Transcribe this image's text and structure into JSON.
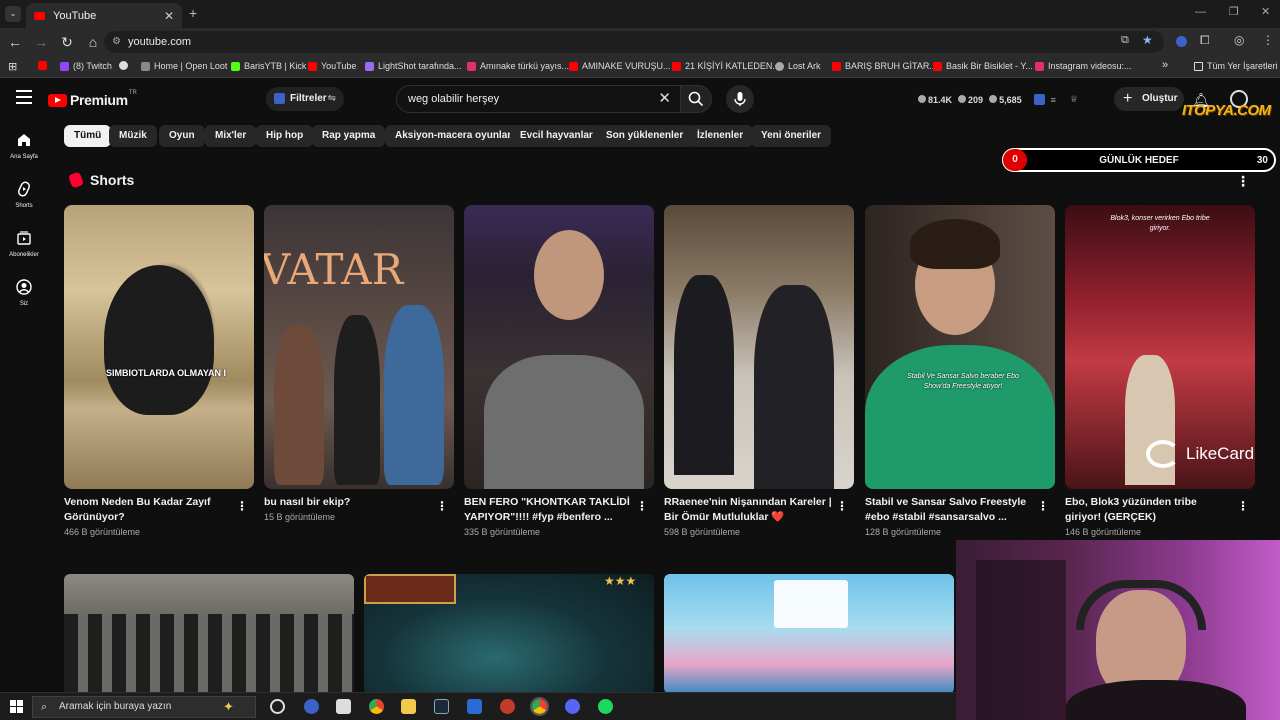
{
  "browser": {
    "tab_title": "YouTube",
    "url": "youtube.com",
    "bookmarks": [
      {
        "label": "(8) Twitch",
        "color": "#9146ff"
      },
      {
        "label": "Home | Open Loot",
        "color": "#888888"
      },
      {
        "label": "BarisYTB | Kick",
        "color": "#53fc18"
      },
      {
        "label": "YouTube",
        "color": "#ff0000"
      },
      {
        "label": "LightShot tarafında...",
        "color": "#9b6cf2"
      },
      {
        "label": "Amınake türkü yayıs...",
        "color": "#e1306c"
      },
      {
        "label": "AMINAKE VURUŞU...",
        "color": "#ff0000"
      },
      {
        "label": "21 KİŞİYİ KATLEDEN...",
        "color": "#ff0000"
      },
      {
        "label": "Lost Ark",
        "color": "#aaaaaa"
      },
      {
        "label": "BARIŞ BRUH GİTAR...",
        "color": "#ff0000"
      },
      {
        "label": "Basik Bir Bisiklet - Y...",
        "color": "#ff0000"
      },
      {
        "label": "Instagram videosu:...",
        "color": "#e1306c"
      }
    ],
    "all_bookmarks": "Tüm Yer İşaretleri"
  },
  "yt_header": {
    "logo": "Premium",
    "logo_region": "TR",
    "filters_label": "Filtreler",
    "search_value": "weg olabilir herşey",
    "stat1": "81.4K",
    "stat2": "209",
    "stat3": "5,685",
    "create_label": "Oluştur"
  },
  "overlay": {
    "watermark": "ITOPYA.COM",
    "goal_start": "0",
    "goal_label": "GÜNLÜK HEDEF",
    "goal_target": "30",
    "likecard": "LikeCard"
  },
  "sidebar": [
    {
      "label": "Ana Sayfa"
    },
    {
      "label": "Shorts"
    },
    {
      "label": "Abonelikler"
    },
    {
      "label": "Siz"
    }
  ],
  "chips": [
    "Tümü",
    "Müzik",
    "Oyun",
    "Mix'ler",
    "Hip hop",
    "Rap yapma",
    "Aksiyon-macera oyunları",
    "Evcil hayvanlar",
    "Son yüklenenler",
    "İzlenenler",
    "Yeni öneriler"
  ],
  "shorts": {
    "section_title": "Shorts",
    "items": [
      {
        "title": "Venom Neden Bu Kadar Zayıf Görünüyor?",
        "views": "466 B görüntüleme",
        "caption": "SIMBIOTLARDA OLMAYAN I"
      },
      {
        "title": "bu nasıl bir ekip?",
        "views": "15 B görüntüleme",
        "caption": "VATAR"
      },
      {
        "title": "BEN FERO \"KHONTKAR TAKLİDİ YAPIYOR\"!!!! #fyp #benfero ...",
        "views": "335 B görüntüleme",
        "caption": ""
      },
      {
        "title": "RRaenee'nin Nişanından Kareler | Bir Ömür Mutluluklar ❤️",
        "views": "598 B görüntüleme",
        "caption": ""
      },
      {
        "title": "Stabil ve Sansar Salvo Freestyle #ebo #stabil #sansarsalvo ...",
        "views": "128 B görüntüleme",
        "caption": "Stabil Ve Sansar Salvo beraber Ebo Show'da Freestyle atıyor!"
      },
      {
        "title": "Ebo, Blok3 yüzünden tribe giriyor! (GERÇEK)",
        "views": "146 B görüntüleme",
        "caption": "Blok3, konser verirken Ebo tribe giriyor."
      }
    ]
  },
  "taskbar": {
    "search_placeholder": "Aramak için buraya yazın"
  }
}
